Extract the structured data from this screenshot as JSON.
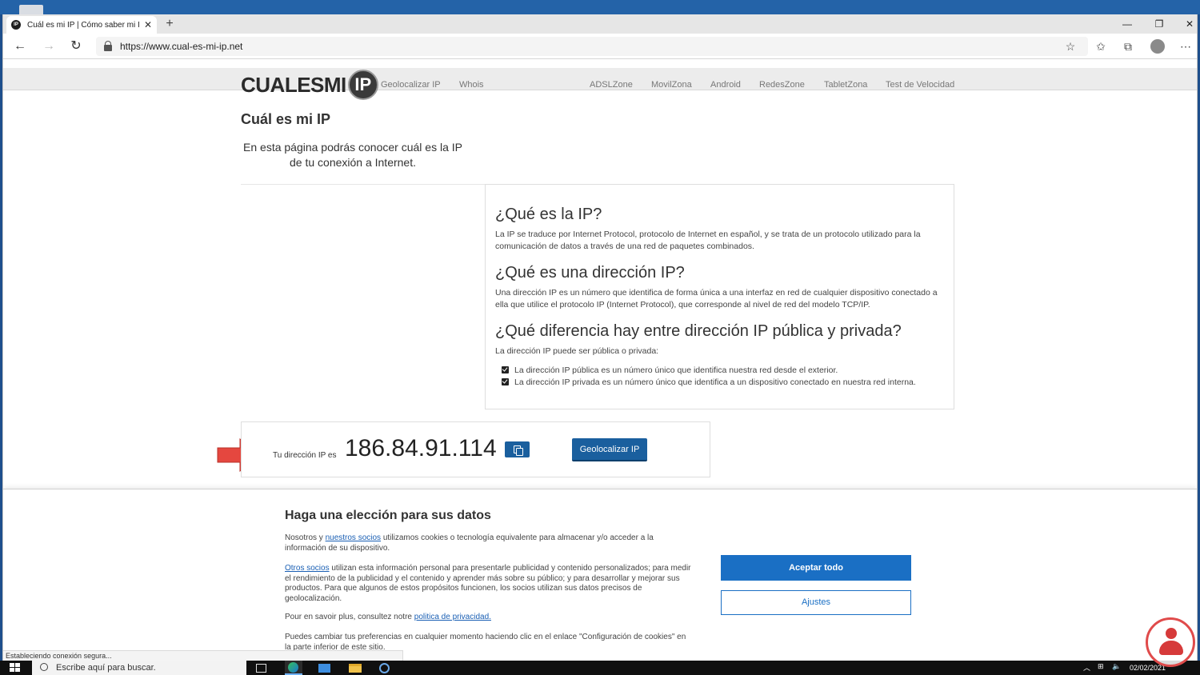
{
  "browser": {
    "tab_title": "Cuál es mi IP | Cómo saber mi IP",
    "tab_favicon": "IP",
    "url": "https://www.cual-es-mi-ip.net",
    "status": "Estableciendo conexión segura..."
  },
  "site": {
    "logo_text": "CUALESMI",
    "logo_ip": "IP",
    "nav": [
      "Geolocalizar IP",
      "Whois",
      "ADSLZone",
      "MovilZona",
      "Android",
      "RedesZone",
      "TabletZona",
      "Test de Velocidad"
    ]
  },
  "main": {
    "title": "Cuál es mi IP",
    "intro": "En esta página podrás conocer cuál es la IP de tu conexión a Internet.",
    "sections": [
      {
        "heading": "¿Qué es la IP?",
        "text": "La IP se traduce por Internet Protocol, protocolo de Internet en español, y se trata de un protocolo utilizado para la comunicación de datos a través de una red de paquetes combinados."
      },
      {
        "heading": "¿Qué es una dirección IP?",
        "text": "Una dirección IP es un número que identifica de forma única a una interfaz en red de cualquier dispositivo conectado a ella que utilice el protocolo IP (Internet Protocol), que corresponde al nivel de red del modelo TCP/IP."
      },
      {
        "heading": "¿Qué diferencia hay entre dirección IP pública y privada?",
        "text": "La dirección IP puede ser pública o privada:"
      }
    ],
    "bullets": [
      "La dirección IP pública es un número único que identifica nuestra red desde el exterior.",
      "La dirección IP privada es un número único que identifica a un dispositivo conectado en nuestra red interna."
    ],
    "ip_label": "Tu dirección IP es",
    "ip_value": "186.84.91.114",
    "geo_button": "Geolocalizar IP"
  },
  "cookie": {
    "title": "Haga una elección para sus datos",
    "p1_pre": "Nosotros y ",
    "p1_link": "nuestros socios",
    "p1_post": " utilizamos cookies o tecnología equivalente para almacenar y/o acceder a la información de su dispositivo.",
    "p2_link": "Otros socios",
    "p2_post": " utilizan esta información personal para presentarle publicidad y contenido personalizados; para medir el rendimiento de la publicidad y el contenido y aprender más sobre su público; y para desarrollar y mejorar sus productos. Para que algunos de estos propósitos funcionen, los socios utilizan sus datos precisos de geolocalización.",
    "p3_pre": "Pour en savoir plus, consultez notre ",
    "p3_link": "politica de privacidad.",
    "p4": "Puedes cambiar tus preferencias en cualquier momento haciendo clic en el enlace \"Configuración de cookies\" en la parte inferior de este sitio.",
    "accept": "Aceptar todo",
    "settings": "Ajustes"
  },
  "taskbar": {
    "search_placeholder": "Escribe aquí para buscar.",
    "date": "02/02/2021"
  },
  "colors": {
    "accent": "#1a5f9e",
    "cookie_accent": "#1a6fc4",
    "arrow": "#e5473f"
  }
}
